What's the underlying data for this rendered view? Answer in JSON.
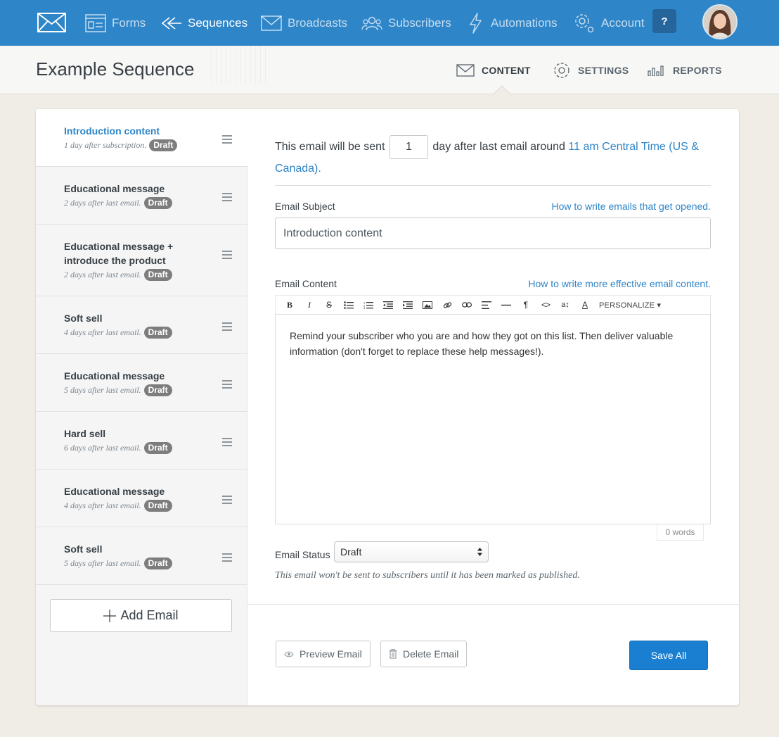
{
  "nav": {
    "items": [
      {
        "label": "Forms",
        "icon": "form-icon"
      },
      {
        "label": "Sequences",
        "icon": "sequences-icon",
        "active": true
      },
      {
        "label": "Broadcasts",
        "icon": "envelope-icon"
      },
      {
        "label": "Subscribers",
        "icon": "users-icon"
      },
      {
        "label": "Automations",
        "icon": "lightning-icon"
      },
      {
        "label": "Account",
        "icon": "gear-icon"
      }
    ],
    "help_label": "?"
  },
  "page": {
    "title": "Example Sequence",
    "tabs": [
      {
        "label": "CONTENT",
        "icon": "envelope-icon",
        "active": true
      },
      {
        "label": "SETTINGS",
        "icon": "gear-icon"
      },
      {
        "label": "REPORTS",
        "icon": "bar-chart-icon"
      }
    ]
  },
  "emails": [
    {
      "title": "Introduction content",
      "meta": "1 day after subscription.",
      "status": "Draft",
      "active": true
    },
    {
      "title": "Educational message",
      "meta": "2 days after last email.",
      "status": "Draft"
    },
    {
      "title": "Educational message + introduce the product",
      "meta": "2 days after last email.",
      "status": "Draft"
    },
    {
      "title": "Soft sell",
      "meta": "4 days after last email.",
      "status": "Draft"
    },
    {
      "title": "Educational message",
      "meta": "5 days after last email.",
      "status": "Draft"
    },
    {
      "title": "Hard sell",
      "meta": "6 days after last email.",
      "status": "Draft"
    },
    {
      "title": "Educational message",
      "meta": "4 days after last email.",
      "status": "Draft"
    },
    {
      "title": "Soft sell",
      "meta": "5 days after last email.",
      "status": "Draft"
    }
  ],
  "add_email_label": "Add Email",
  "editor": {
    "schedule_prefix": "This email will be sent",
    "schedule_days": "1",
    "schedule_suffix": "day after last email around",
    "schedule_time_link": "11 am Central Time (US & Canada).",
    "subject_label": "Email Subject",
    "subject_help": "How to write emails that get opened.",
    "subject_value": "Introduction content",
    "content_label": "Email Content",
    "content_help": "How to write more effective email content.",
    "toolbar": {
      "buttons": [
        "bold-icon",
        "italic-icon",
        "strikethrough-icon",
        "bullet-list-icon",
        "numbered-list-icon",
        "outdent-icon",
        "indent-icon",
        "image-icon",
        "link-icon",
        "unlink-icon",
        "align-left-icon",
        "horizontal-rule-icon",
        "paragraph-icon",
        "code-icon",
        "font-size-icon",
        "text-color-icon"
      ],
      "personalize_label": "PERSONALIZE"
    },
    "body_text": "Remind your subscriber who you are and how they got on this list. Then deliver valuable information (don't forget to replace these help messages!).",
    "word_count": "0 words",
    "status_label": "Email Status",
    "status_value": "Draft",
    "status_note": "This email won't be sent to subscribers until it has been marked as published."
  },
  "actions": {
    "preview_label": "Preview Email",
    "delete_label": "Delete Email",
    "save_label": "Save All"
  },
  "colors": {
    "nav_bg": "#2e85c8",
    "accent_link": "#2e85c8",
    "save_button": "#1a7fd1",
    "draft_badge": "#7d7d7d"
  }
}
